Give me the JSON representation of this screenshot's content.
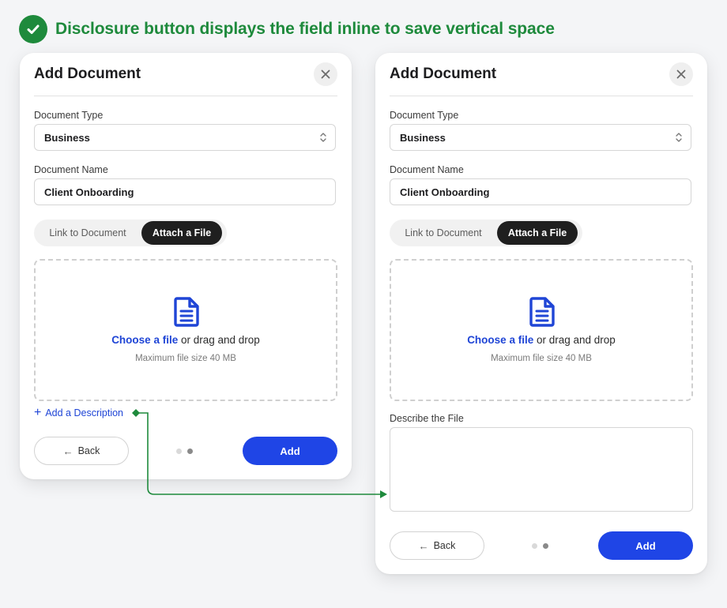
{
  "heading": {
    "text": "Disclosure button displays the field inline to save vertical space"
  },
  "colors": {
    "success": "#1e8a3c",
    "primary": "#1f45e6",
    "link": "#1f45d6",
    "segment_active": "#1f1f1f"
  },
  "cards": [
    {
      "title": "Add Document",
      "document_type": {
        "label": "Document Type",
        "value": "Business"
      },
      "document_name": {
        "label": "Document Name",
        "value": "Client Onboarding"
      },
      "segmented": {
        "options": [
          "Link to Document",
          "Attach a File"
        ],
        "selected": "Attach a File"
      },
      "dropzone": {
        "link_text": "Choose a file",
        "rest_text": " or drag and drop",
        "hint": "Maximum file size 40 MB",
        "icon": "document-icon"
      },
      "disclosure": {
        "label": "Add a Description",
        "icon": "plus-icon"
      },
      "footer": {
        "back_label": "Back",
        "add_label": "Add",
        "page": 2,
        "pages": 2
      }
    },
    {
      "title": "Add Document",
      "document_type": {
        "label": "Document Type",
        "value": "Business"
      },
      "document_name": {
        "label": "Document Name",
        "value": "Client Onboarding"
      },
      "segmented": {
        "options": [
          "Link to Document",
          "Attach a File"
        ],
        "selected": "Attach a File"
      },
      "dropzone": {
        "link_text": "Choose a file",
        "rest_text": " or drag and drop",
        "hint": "Maximum file size 40 MB",
        "icon": "document-icon"
      },
      "description": {
        "label": "Describe the File",
        "value": ""
      },
      "footer": {
        "back_label": "Back",
        "add_label": "Add",
        "page": 2,
        "pages": 2
      }
    }
  ]
}
